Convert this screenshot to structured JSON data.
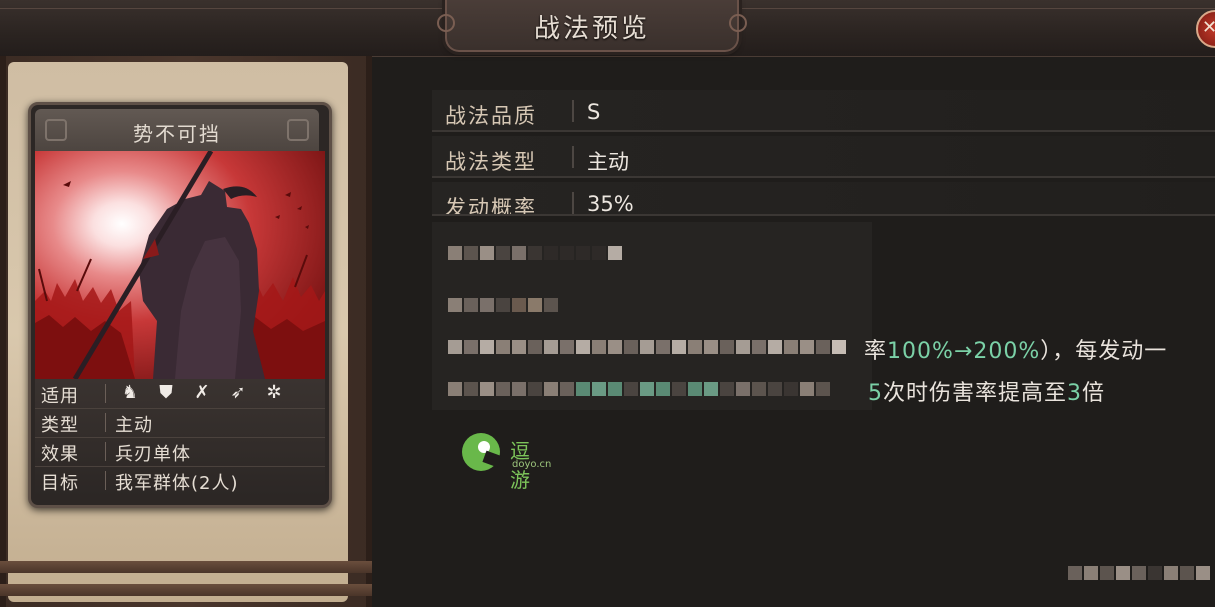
{
  "header": {
    "title": "战法预览",
    "close_icon": "close-icon"
  },
  "card": {
    "name": "势不可挡",
    "stats": [
      {
        "key": "适用",
        "icons": [
          "cavalry-icon",
          "shield-icon",
          "crossbow-icon",
          "spear-icon",
          "wheel-icon"
        ]
      },
      {
        "key": "类型",
        "value": "主动"
      },
      {
        "key": "效果",
        "value": "兵刃单体"
      },
      {
        "key": "目标",
        "value": "我军群体(2人)"
      }
    ]
  },
  "details": {
    "rows": [
      {
        "key": "战法品质",
        "value": "S"
      },
      {
        "key": "战法类型",
        "value": "主动"
      },
      {
        "key": "发动概率",
        "value": "35%"
      }
    ],
    "description_line1_visible": "率",
    "description_line1_pct": "100%→200%",
    "description_line1_tail": "），每发动一",
    "description_line2_num": "5",
    "description_line2_mid": "次时伤害率提高至",
    "description_line2_mult": "3",
    "description_line2_tail": "倍"
  },
  "watermark": {
    "text_cn": "逗游",
    "text_en": "doyo.cn"
  },
  "colors": {
    "accent_green": "#7bd1a7",
    "text_gold": "#d6c7b4",
    "panel_bg": "#1f1d1b"
  }
}
